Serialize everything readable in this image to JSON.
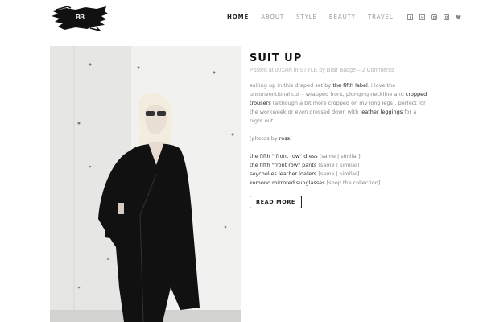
{
  "site": {
    "logo_text": "BB"
  },
  "nav": {
    "items": [
      {
        "label": "HOME",
        "active": true
      },
      {
        "label": "ABOUT",
        "active": false
      },
      {
        "label": "STYLE",
        "active": false
      },
      {
        "label": "BEAUTY",
        "active": false
      },
      {
        "label": "TRAVEL",
        "active": false
      }
    ],
    "social_icons": [
      "facebook-icon",
      "twitter-icon",
      "instagram-icon",
      "pinterest-icon",
      "heart-icon"
    ]
  },
  "post": {
    "title": "SUIT UP",
    "meta": {
      "prefix": "Posted at ",
      "date": "00:04h",
      "in": " in ",
      "category": "STYLE",
      "by": " by ",
      "author": "Blair Badge",
      "sep": " – ",
      "comments": "2 Comments"
    },
    "body": {
      "t1": "suiting up in this draped set by ",
      "l1": "the fifth label",
      "t2": ". i love the unconventional cut – wrapped front, plunging neckline and ",
      "l2": "cropped trousers",
      "t3": " (although a bit more cropped on my long legs), perfect for the workweek or even dressed down with ",
      "l3": "leather leggings",
      "t4": " for a night out."
    },
    "credits": {
      "prefix": "[photos by ",
      "name": "ross",
      "suffix": "]"
    },
    "items": [
      {
        "name": "the fifth \" front row\" dress",
        "links": "[same | similar]"
      },
      {
        "name": "the fifth \"front row\" pants",
        "links": "[same | similar]"
      },
      {
        "name": "seychelles leather loafers",
        "links": "[same | similar]"
      },
      {
        "name": "komono mirrored sunglasses",
        "links": "[shop the collection]"
      }
    ],
    "read_more": "READ MORE"
  }
}
